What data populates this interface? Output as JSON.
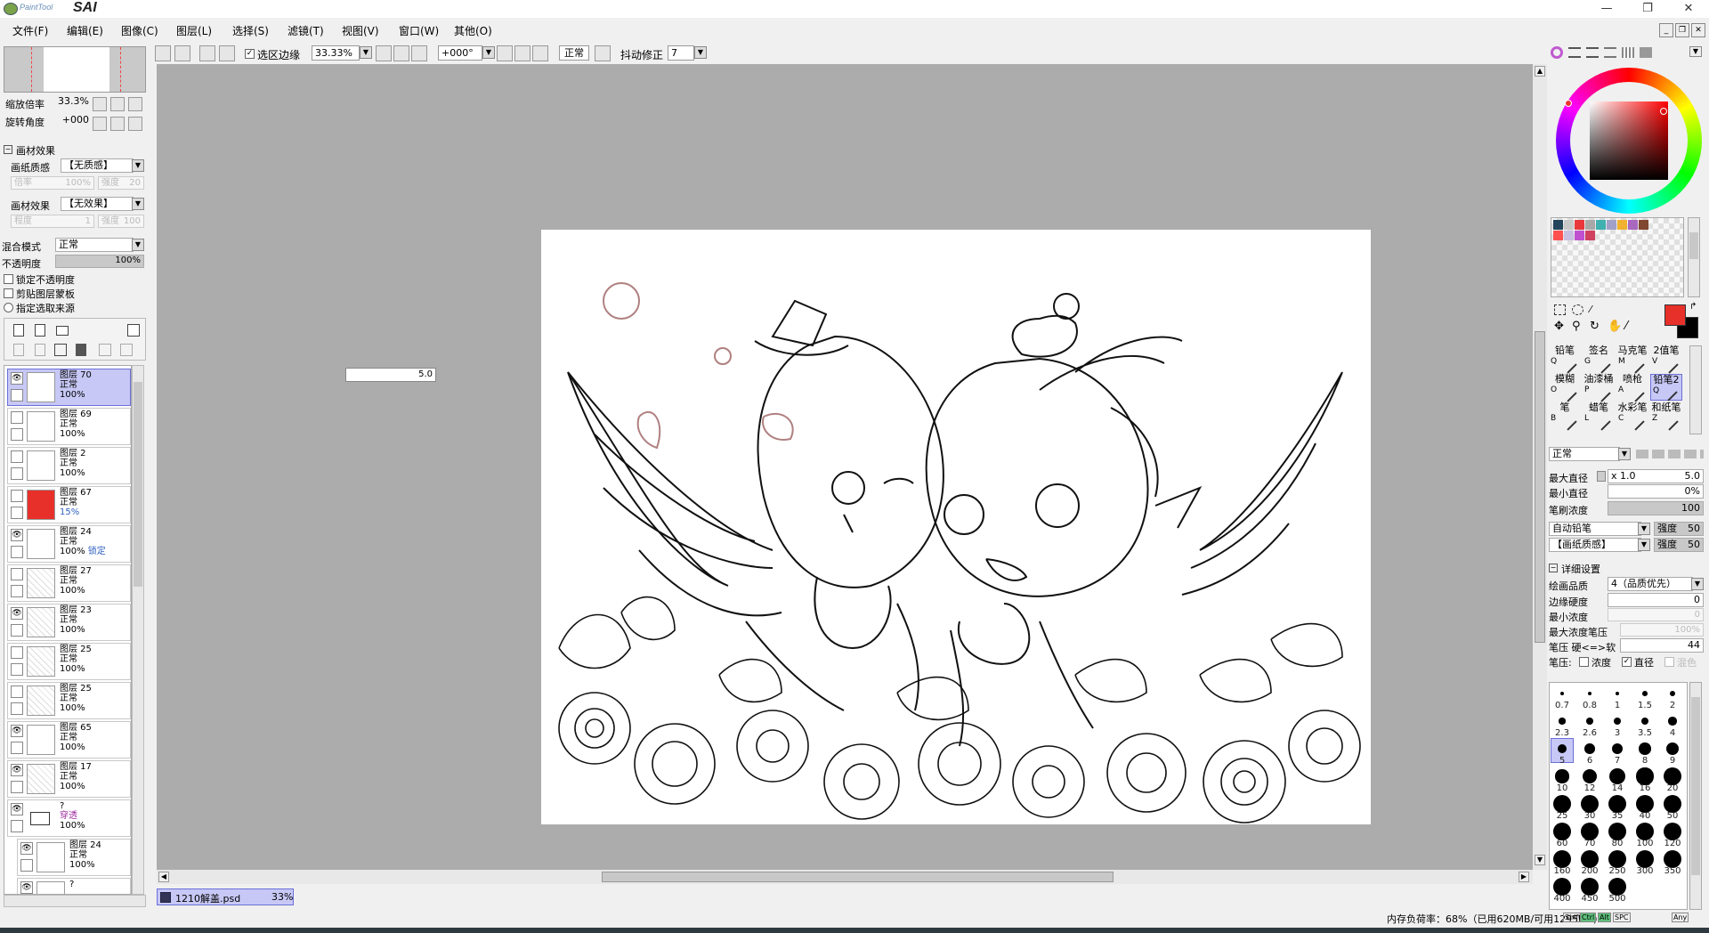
{
  "app": {
    "logo_small": "PaintTool",
    "logo_big": "SAI"
  },
  "window_controls": {
    "minimize": "—",
    "restore": "❐",
    "close": "✕"
  },
  "menu": [
    "文件(F)",
    "编辑(E)",
    "图像(C)",
    "图层(L)",
    "选择(S)",
    "滤镜(T)",
    "视图(V)",
    "窗口(W)",
    "其他(O)"
  ],
  "toolbar": {
    "selection_edge_label": "选区边缘",
    "selection_edge_checked": true,
    "zoom": "33.33%",
    "rotation": "+000°",
    "blend": "正常",
    "stabilizer_label": "抖动修正",
    "stabilizer_value": "7"
  },
  "navigator": {
    "zoom_label": "缩放倍率",
    "zoom_value": "33.3%",
    "rotate_label": "旋转角度",
    "rotate_value": "+000"
  },
  "texture": {
    "section_title": "画材效果",
    "paper_label": "画纸质感",
    "paper_value": "【无质感】",
    "scale_label": "倍率",
    "scale_value": "100%",
    "strength_label": "强度",
    "strength_value": "20",
    "effect_label": "画材效果",
    "effect_value": "【无效果】",
    "degree_label": "程度",
    "degree_value": "1",
    "strength2_label": "强度",
    "strength2_value": "100"
  },
  "layer_props": {
    "blend_label": "混合模式",
    "blend_value": "正常",
    "opacity_label": "不透明度",
    "opacity_value": "100%",
    "opacity_fraction": 1.0,
    "lock_opacity": "锁定不透明度",
    "clip_group": "剪贴图层蒙板",
    "selection_source": "指定选取来源"
  },
  "layers": [
    {
      "name": "图层 70",
      "mode": "正常",
      "opacity": "100%",
      "visible": true,
      "selected": true,
      "thumb": "white"
    },
    {
      "name": "图层 69",
      "mode": "正常",
      "opacity": "100%",
      "visible": false,
      "thumb": "white"
    },
    {
      "name": "图层 2",
      "mode": "正常",
      "opacity": "100%",
      "visible": false,
      "thumb": "white"
    },
    {
      "name": "图层 67",
      "mode": "正常",
      "opacity": "15%",
      "visible": false,
      "thumb": "red"
    },
    {
      "name": "图层 24",
      "mode": "正常",
      "opacity": "100%",
      "visible": true,
      "thumb": "white",
      "extra": "锁定"
    },
    {
      "name": "图层 27",
      "mode": "正常",
      "opacity": "100%",
      "visible": false,
      "thumb": "sketch"
    },
    {
      "name": "图层 23",
      "mode": "正常",
      "opacity": "100%",
      "visible": true,
      "thumb": "sketch"
    },
    {
      "name": "图层 25",
      "mode": "正常",
      "opacity": "100%",
      "visible": false,
      "thumb": "sketch"
    },
    {
      "name": "图层 25",
      "mode": "正常",
      "opacity": "100%",
      "visible": false,
      "thumb": "sketch"
    },
    {
      "name": "图层 65",
      "mode": "正常",
      "opacity": "100%",
      "visible": true,
      "thumb": "white"
    },
    {
      "name": "图层 17",
      "mode": "正常",
      "opacity": "100%",
      "visible": true,
      "thumb": "sketch"
    },
    {
      "name": "?",
      "mode": "穿透",
      "opacity": "100%",
      "visible": true,
      "thumb": "folder"
    },
    {
      "name": "图层 24",
      "mode": "正常",
      "opacity": "100%",
      "visible": true,
      "thumb": "white",
      "indent": true
    },
    {
      "name": "?",
      "mode": "...",
      "opacity": "",
      "visible": true,
      "thumb": "white",
      "indent": true
    }
  ],
  "canvas_popup": {
    "value": "5.0"
  },
  "document_tab": {
    "name": "1210解盖.psd",
    "zoom": "33%"
  },
  "status": {
    "memory": "内存负荷率：68%（已用620MB/可用1295MB）",
    "keys": [
      "Shift",
      "Ctrl",
      "Alt",
      "SPC",
      "Any"
    ]
  },
  "colors": {
    "accent_primary": "#e8302a",
    "accent_secondary": "#000000",
    "selected_layer": "#c7c8f5"
  },
  "brush_tools": [
    {
      "name": "铅笔",
      "key": "Q"
    },
    {
      "name": "签名",
      "key": "G"
    },
    {
      "name": "马克笔",
      "key": "M"
    },
    {
      "name": "2值笔",
      "key": "V"
    },
    {
      "name": "模糊",
      "key": "O"
    },
    {
      "name": "油漆桶",
      "key": "P"
    },
    {
      "name": "喷枪",
      "key": "A"
    },
    {
      "name": "铅笔2",
      "key": "Q",
      "selected": true
    },
    {
      "name": "笔",
      "key": "B"
    },
    {
      "name": "蜡笔",
      "key": "L"
    },
    {
      "name": "水彩笔",
      "key": "C"
    },
    {
      "name": "和纸笔",
      "key": "Z"
    }
  ],
  "brush_settings": {
    "mode": "正常",
    "max_size_label": "最大直径",
    "max_size_mult": "x 1.0",
    "max_size_value": "5.0",
    "min_size_label": "最小直径",
    "min_size_value": "0%",
    "density_label": "笔刷浓度",
    "density_value": "100",
    "shape": "自动铅笔",
    "shape_strength_label": "强度",
    "shape_strength": "50",
    "texture": "【画纸质感】",
    "texture_strength_label": "强度",
    "texture_strength": "50",
    "detail_title": "详细设置",
    "quality_label": "绘画品质",
    "quality_value": "4（品质优先）",
    "edge_label": "边缘硬度",
    "edge_value": "0",
    "min_density_label": "最小浓度",
    "min_density_value": "0",
    "max_pressure_label": "最大浓度笔压",
    "max_pressure_value": "100%",
    "pressure_label": "笔压 硬<=>软",
    "pressure_value": "44",
    "pressure_opts_label": "笔压:",
    "opt_density": "浓度",
    "opt_size": "直径",
    "opt_blend": "混色"
  },
  "brush_sizes": [
    "0.7",
    "0.8",
    "1",
    "1.5",
    "2",
    "2.3",
    "2.6",
    "3",
    "3.5",
    "4",
    "5",
    "6",
    "7",
    "8",
    "9",
    "10",
    "12",
    "14",
    "16",
    "20",
    "25",
    "30",
    "35",
    "40",
    "50",
    "60",
    "70",
    "80",
    "100",
    "120",
    "160",
    "200",
    "250",
    "300",
    "350",
    "400",
    "450",
    "500"
  ],
  "selected_brush_size": "5",
  "palette": [
    "#24445c",
    "#c8c8c8",
    "#e8383c",
    "#a8a8a8",
    "#40b0b0",
    "#a0a0c8",
    "#f0b030",
    "#a868c0",
    "#804830",
    "#ff5050",
    "#c8c0e0",
    "#c050d0",
    "#d04060"
  ]
}
